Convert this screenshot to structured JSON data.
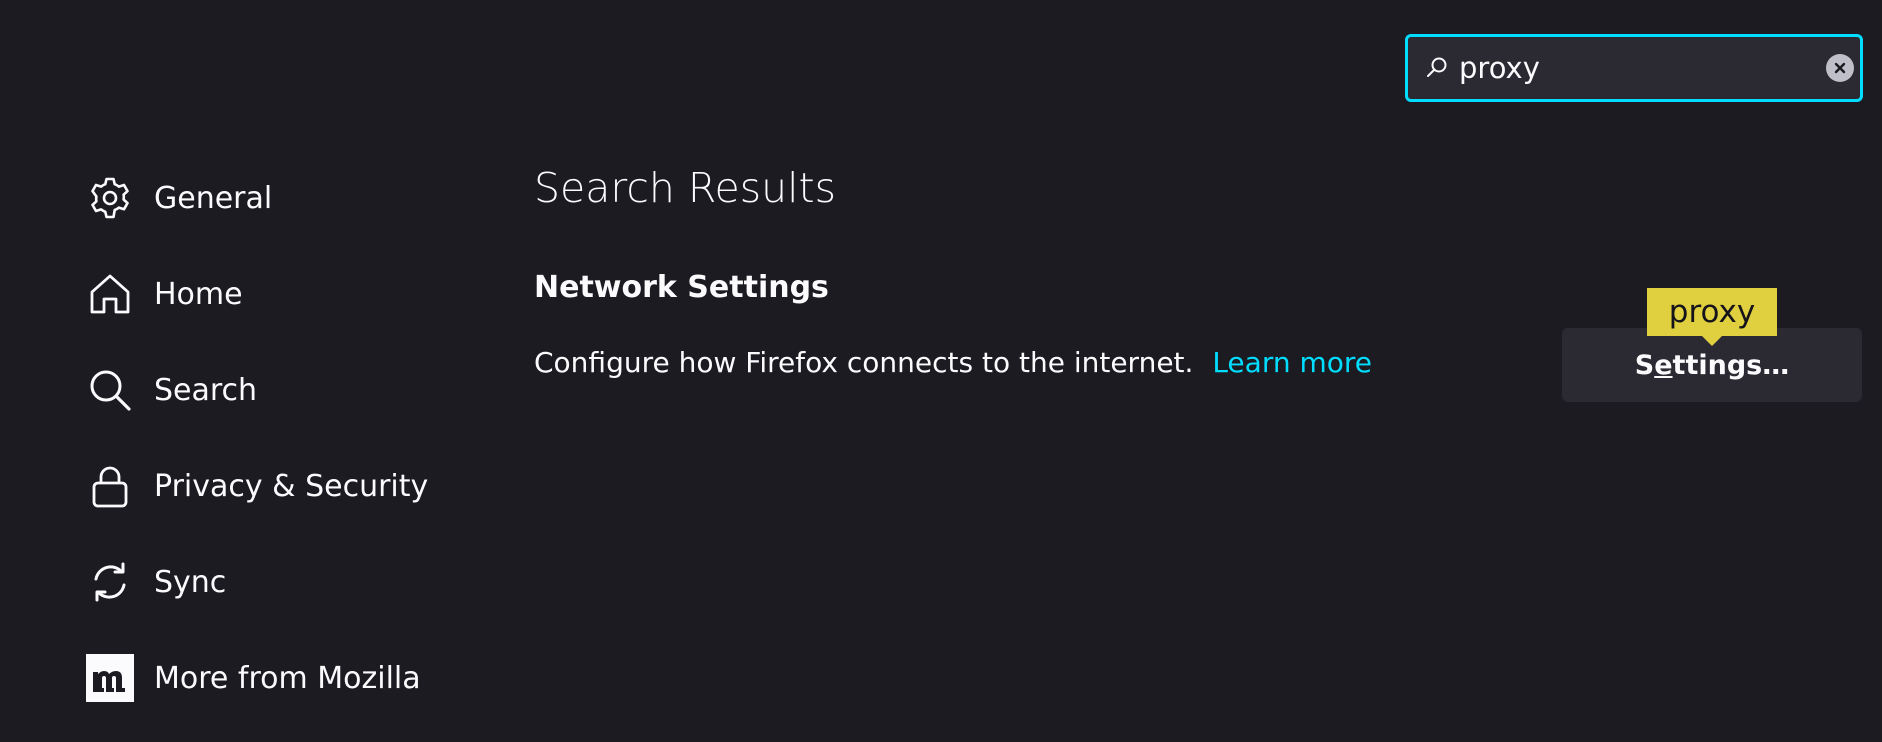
{
  "search": {
    "value": "proxy",
    "placeholder": "",
    "icon": "search-icon",
    "clear_icon": "clear-icon"
  },
  "sidebar": {
    "items": [
      {
        "label": "General",
        "icon": "gear-icon"
      },
      {
        "label": "Home",
        "icon": "home-icon"
      },
      {
        "label": "Search",
        "icon": "search-icon"
      },
      {
        "label": "Privacy & Security",
        "icon": "lock-icon"
      },
      {
        "label": "Sync",
        "icon": "sync-icon"
      },
      {
        "label": "More from Mozilla",
        "icon": "mozilla-icon"
      }
    ]
  },
  "main": {
    "title": "Search Results",
    "section": {
      "heading": "Network Settings",
      "description": "Configure how Firefox connects to the internet.",
      "learn_more": "Learn more",
      "button": {
        "before": "S",
        "accesskey": "e",
        "after": "ttings…"
      },
      "tooltip": "proxy"
    }
  },
  "colors": {
    "background": "#1c1b22",
    "accent": "#00ddff",
    "button_bg": "#2b2a33",
    "highlight": "#e0cf3e",
    "text": "#fbfbfe"
  }
}
